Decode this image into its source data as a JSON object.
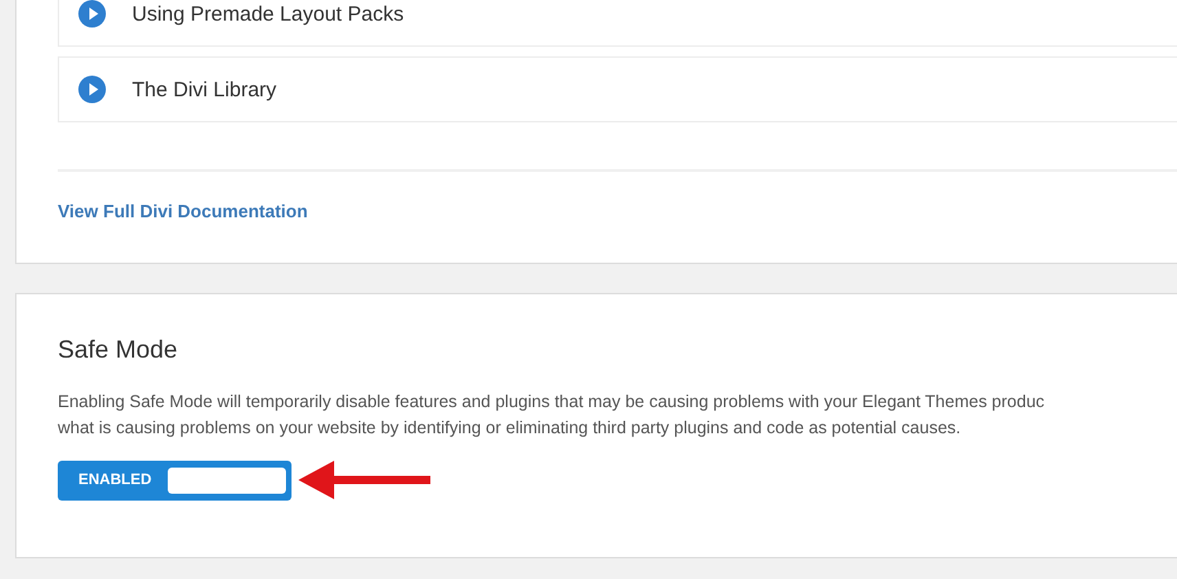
{
  "documentation": {
    "items": [
      {
        "title": "Using Premade Layout Packs"
      },
      {
        "title": "The Divi Library"
      }
    ],
    "link": "View Full Divi Documentation"
  },
  "safe_mode": {
    "title": "Safe Mode",
    "description": [
      "Enabling Safe Mode will temporarily disable features and plugins that may be causing problems with your Elegant Themes produc",
      "what is causing problems on your website by identifying or eliminating third party plugins and code as potential causes."
    ],
    "toggle": {
      "label": "ENABLED",
      "on": true
    }
  }
}
